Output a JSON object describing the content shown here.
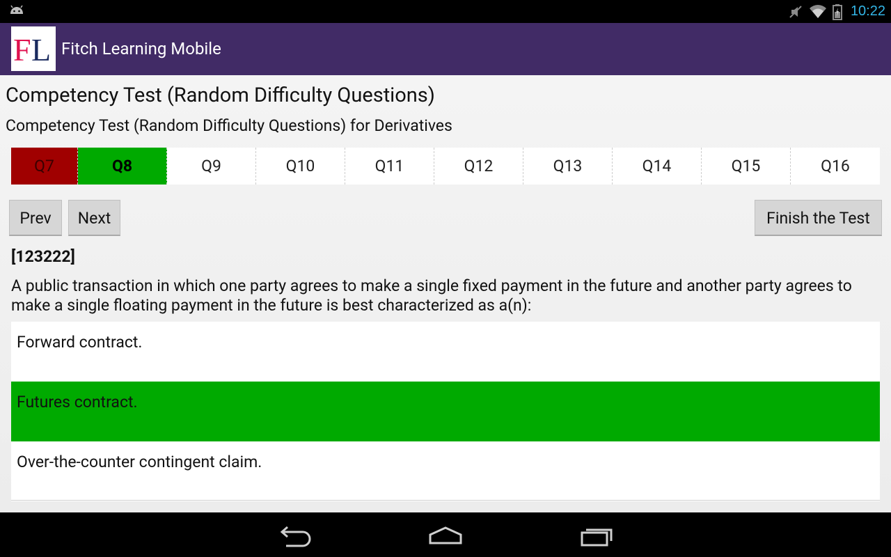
{
  "status_bar": {
    "time": "10:22"
  },
  "app": {
    "logo_text": "FL",
    "title": "Fitch Learning Mobile"
  },
  "page": {
    "title": "Competency Test (Random Difficulty Questions)",
    "subtitle": "Competency Test (Random Difficulty Questions) for Derivatives"
  },
  "question_tabs": [
    {
      "label": "Q7",
      "state": "wrong"
    },
    {
      "label": "Q8",
      "state": "current"
    },
    {
      "label": "Q9",
      "state": "unanswered"
    },
    {
      "label": "Q10",
      "state": "unanswered"
    },
    {
      "label": "Q11",
      "state": "unanswered"
    },
    {
      "label": "Q12",
      "state": "unanswered"
    },
    {
      "label": "Q13",
      "state": "unanswered"
    },
    {
      "label": "Q14",
      "state": "unanswered"
    },
    {
      "label": "Q15",
      "state": "unanswered"
    },
    {
      "label": "Q16",
      "state": "unanswered"
    }
  ],
  "buttons": {
    "prev": "Prev",
    "next": "Next",
    "finish": "Finish the Test"
  },
  "question": {
    "id": "[123222]",
    "text": "A public transaction in which one party agrees to make a single fixed payment in the future and another party agrees to make a single floating payment in the future is best characterized as a(n):",
    "answers": [
      {
        "text": "Forward contract.",
        "selected": false
      },
      {
        "text": "Futures contract.",
        "selected": true
      },
      {
        "text": "Over-the-counter contingent claim.",
        "selected": false
      }
    ]
  },
  "colors": {
    "action_bar": "#412b66",
    "correct": "#00aa00",
    "wrong": "#a00000",
    "logo_red": "#e0114f",
    "logo_navy": "#1a2a5e",
    "time": "#33b5e5"
  }
}
